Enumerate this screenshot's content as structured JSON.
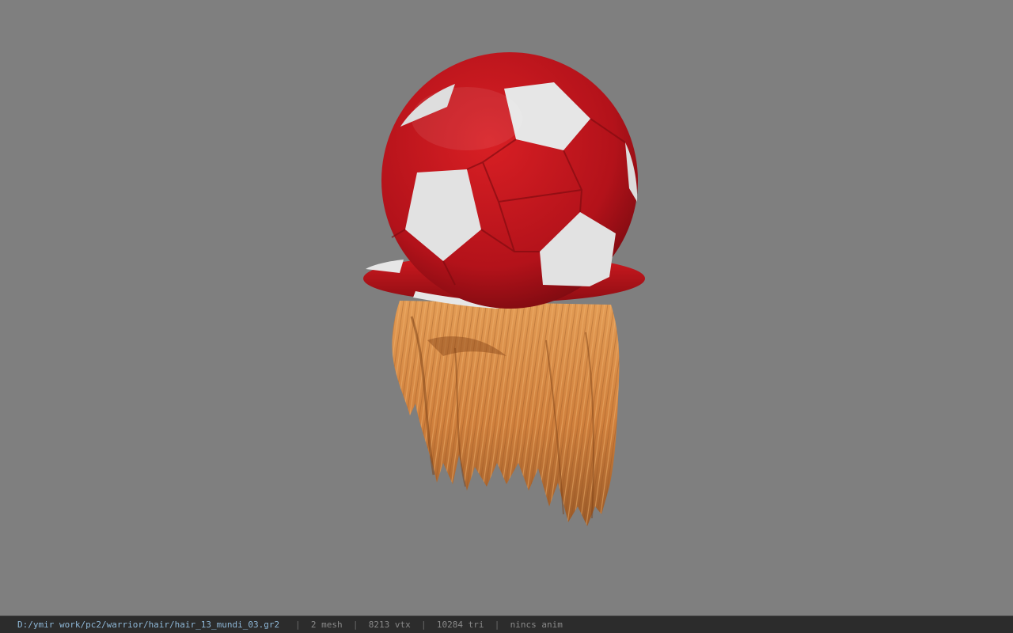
{
  "viewport": {
    "background": "#7f7f7f",
    "model": {
      "subject": "hair-with-soccer-ball-hat",
      "ball_colors": {
        "red": "#c4141a",
        "white": "#e6e6e6"
      },
      "hair_color": "#d9863f"
    }
  },
  "status_bar": {
    "file_path": "D:/ymir work/pc2/warrior/hair/hair_13_mundi_03.gr2",
    "separator": "|",
    "mesh": "2 mesh",
    "vertices": "8213 vtx",
    "triangles": "10284 tri",
    "animation": "nincs anim"
  }
}
